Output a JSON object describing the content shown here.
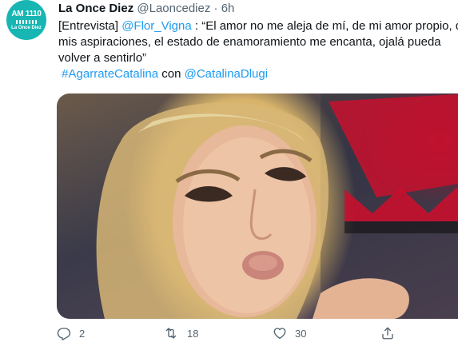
{
  "account": {
    "avatar_text": "AM 1110",
    "avatar_brand": "La Once Diez",
    "display_name": "La Once Diez",
    "handle": "@Laoncediez",
    "separator": "·",
    "time": "6h"
  },
  "tweet": {
    "line1_prefix": "[Entrevista] ",
    "mention_flor": "@Flor_Vigna",
    "line1_rest": " : “El amor no me aleja de mí, de mi amor propio, de",
    "line2": "mis aspiraciones, el estado de enamoramiento me encanta, ojalá pueda",
    "line3": "volver a sentirlo”",
    "hashtag": "#AgarrateCatalina",
    "con": " con ",
    "mention_catalina": "@CatalinaDlugi"
  },
  "actions": {
    "reply_count": "2",
    "retweet_count": "18",
    "like_count": "30"
  },
  "colors": {
    "link": "#1d9bf0",
    "muted": "#536471",
    "avatar_bg": "#17b6b3"
  },
  "icons": [
    "reply-icon",
    "retweet-icon",
    "like-icon",
    "share-icon"
  ]
}
